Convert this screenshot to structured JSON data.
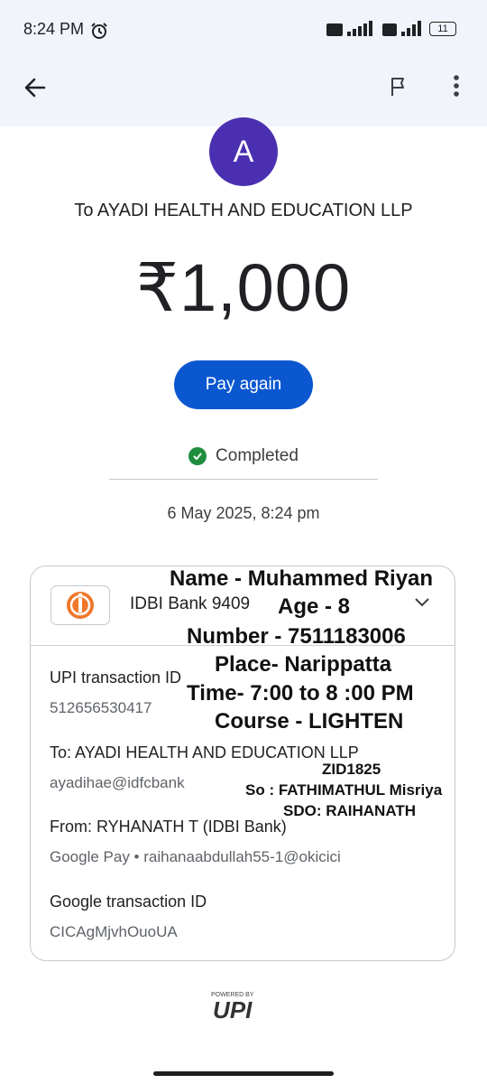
{
  "status_bar": {
    "time": "8:24 PM",
    "battery": "11"
  },
  "header": {
    "back": "back",
    "flag": "report",
    "more": "more options"
  },
  "payee": {
    "avatar_letter": "A",
    "to_label": "To AYADI HEALTH AND EDUCATION LLP",
    "amount": "₹1,000",
    "pay_again": "Pay again",
    "status": "Completed",
    "date": "6 May 2025, 8:24 pm"
  },
  "card": {
    "bank": "IDBI Bank 9409",
    "upi_label": "UPI transaction ID",
    "upi_value": "512656530417",
    "to_label": "To: AYADI HEALTH AND EDUCATION LLP",
    "to_value": "ayadihae@idfcbank",
    "from_label": "From: RYHANATH T (IDBI Bank)",
    "from_value": "Google Pay • raihanaabdullah55-1@okicici",
    "gtid_label": "Google transaction ID",
    "gtid_value": "CICAgMjvhOuoUA"
  },
  "overlay": {
    "name": "Name - Muhammed Riyan",
    "age": "Age - 8",
    "number": "Number - 7511183006",
    "place": "Place- Narippatta",
    "time": "Time- 7:00 to 8 :00 PM",
    "course": "Course - LIGHTEN",
    "zid": "ZID1825",
    "so": "So : FATHIMATHUL Misriya",
    "sdo": "SDO: RAIHANATH"
  },
  "footer": {
    "powered_by": "POWERED BY",
    "upi": "UPI"
  },
  "colors": {
    "primary": "#0b57d0",
    "avatar": "#4a2fb0",
    "success": "#1e8e3e",
    "header_bg": "#f1f4fb"
  }
}
